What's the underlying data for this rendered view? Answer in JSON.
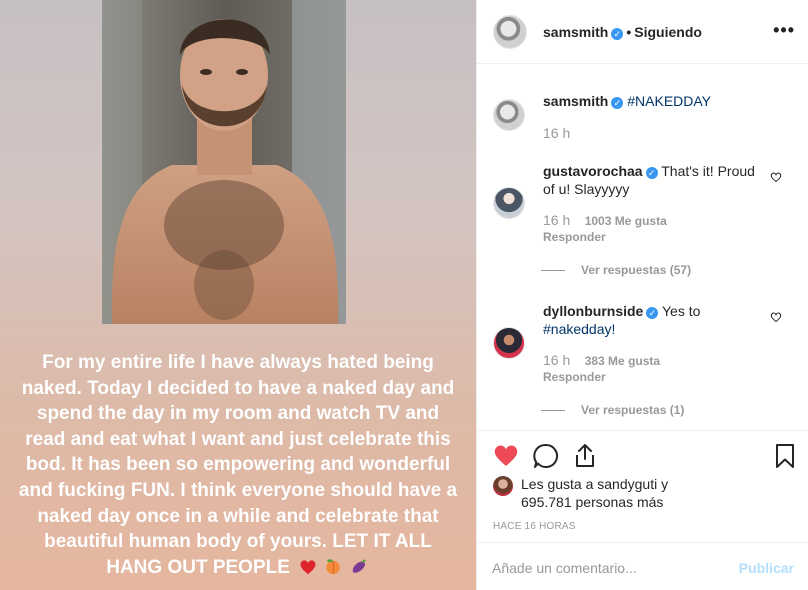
{
  "media": {
    "caption_lines": [
      "For my entire life I have always hated being",
      "naked. Today I decided to have a naked day and",
      "spend the day in my room and watch TV and",
      "read and eat what I want and just celebrate this",
      "bod. It has been so empowering and wonderful",
      "and fucking FUN. I think everyone should have a",
      "naked day once in a while and celebrate that",
      "beautiful human body of yours. LET IT ALL",
      "HANG OUT PEOPLE"
    ],
    "emojis": [
      "heart-emoji",
      "peach-emoji",
      "eggplant-emoji"
    ]
  },
  "header": {
    "username": "samsmith",
    "separator": "•",
    "follow_status": "Siguiendo",
    "more_glyph": "•••"
  },
  "post_caption": {
    "username": "samsmith",
    "text": "#NAKEDDAY",
    "time": "16 h"
  },
  "comments": [
    {
      "username": "gustavorochaa",
      "text_line1": "That's it! Proud",
      "text_line2": "of u! Slayyyyy",
      "time": "16 h",
      "likes": "1003 Me gusta",
      "reply": "Responder",
      "view_replies": "Ver respuestas (57)"
    },
    {
      "username": "dyllonburnside",
      "text_line1": "Yes to",
      "text_line2": "#nakedday!",
      "time": "16 h",
      "likes": "383 Me gusta",
      "reply": "Responder",
      "view_replies": "Ver respuestas (1)"
    }
  ],
  "actions": {
    "likes_line1": "Les gusta a sandyguti y",
    "likes_line2": "695.781 personas más",
    "timestamp": "HACE 16 HORAS",
    "like_color": "#ed4956"
  },
  "add_comment": {
    "placeholder": "Añade un comentario...",
    "publish": "Publicar"
  }
}
